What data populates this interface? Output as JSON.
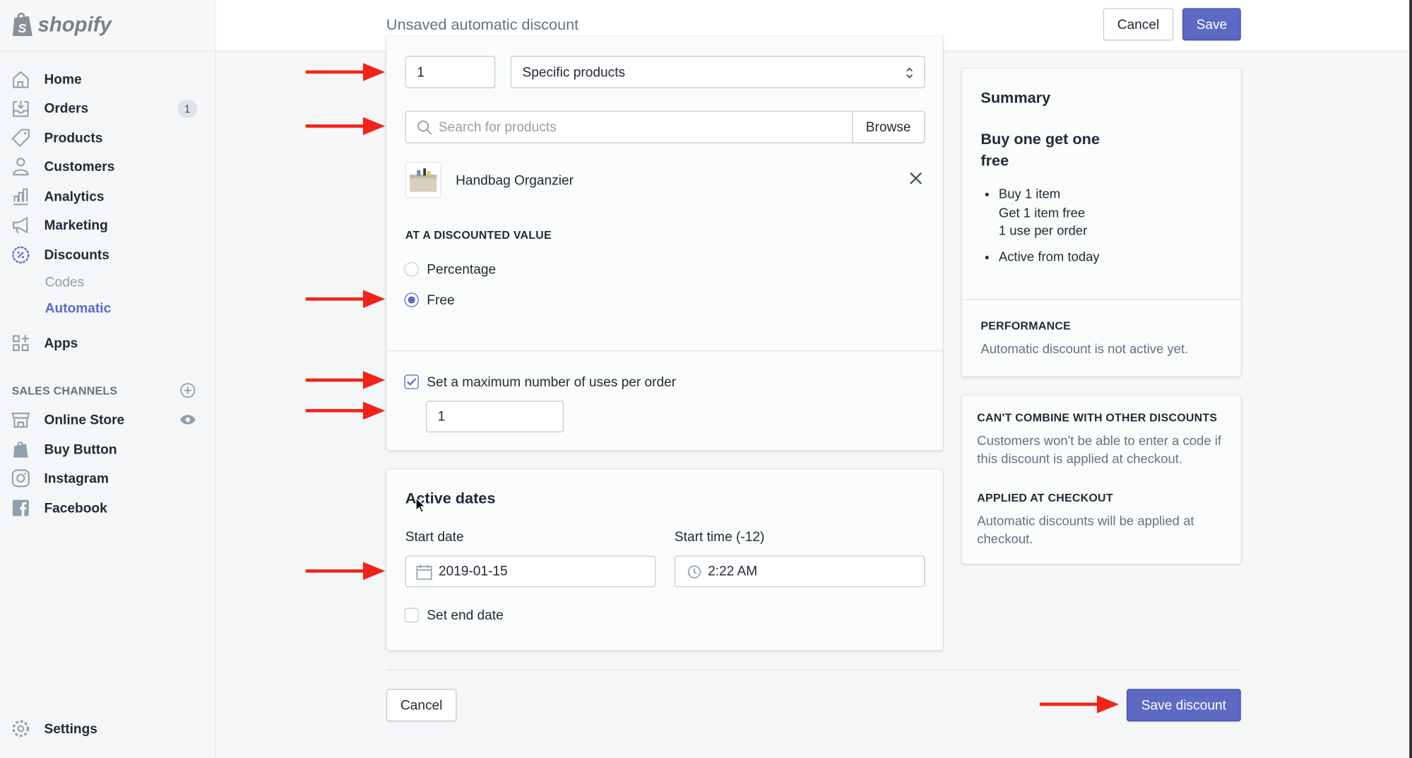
{
  "brand": "shopify",
  "sidebar": {
    "items": [
      {
        "label": "Home",
        "icon": "home-icon"
      },
      {
        "label": "Orders",
        "icon": "orders-icon",
        "badge": "1"
      },
      {
        "label": "Products",
        "icon": "tag-icon"
      },
      {
        "label": "Customers",
        "icon": "person-icon"
      },
      {
        "label": "Analytics",
        "icon": "bar-chart-icon"
      },
      {
        "label": "Marketing",
        "icon": "megaphone-icon"
      },
      {
        "label": "Discounts",
        "icon": "discount-icon"
      }
    ],
    "sub_items": [
      {
        "label": "Codes"
      },
      {
        "label": "Automatic"
      }
    ],
    "apps": "Apps",
    "sales_channels_heading": "SALES CHANNELS",
    "channels": [
      {
        "label": "Online Store"
      },
      {
        "label": "Buy Button"
      },
      {
        "label": "Instagram"
      },
      {
        "label": "Facebook"
      }
    ],
    "settings": "Settings"
  },
  "topbar": {
    "title": "Unsaved automatic discount",
    "cancel": "Cancel",
    "save": "Save"
  },
  "form": {
    "quantity": "1",
    "applies_to": "Specific products",
    "search_placeholder": "Search for products",
    "browse": "Browse",
    "product": "Handbag Organzier",
    "discounted_value_heading": "AT A DISCOUNTED VALUE",
    "options": [
      "Percentage",
      "Free"
    ],
    "selected_option": "Free",
    "max_uses_label": "Set a maximum number of uses per order",
    "max_uses_checked": true,
    "max_uses_value": "1"
  },
  "active_dates": {
    "title": "Active dates",
    "start_date_label": "Start date",
    "start_date": "2019-01-15",
    "start_time_label": "Start time (-12)",
    "start_time": "2:22 AM",
    "end_date_label": "Set end date"
  },
  "footer": {
    "cancel": "Cancel",
    "save": "Save discount"
  },
  "summary": {
    "title": "Summary",
    "name": "Buy one get one free",
    "bullets": [
      [
        "Buy 1 item",
        "Get 1 item free",
        "1 use per order"
      ],
      [
        "Active from today"
      ]
    ],
    "performance_heading": "PERFORMANCE",
    "performance_text": "Automatic discount is not active yet."
  },
  "info": {
    "combine_heading": "CAN'T COMBINE WITH OTHER DISCOUNTS",
    "combine_text": "Customers won't be able to enter a code if this discount is applied at checkout.",
    "checkout_heading": "APPLIED AT CHECKOUT",
    "checkout_text": "Automatic discounts will be applied at checkout."
  },
  "colors": {
    "accent": "#5c6ac4",
    "annotation_arrow": "#f2231a"
  }
}
